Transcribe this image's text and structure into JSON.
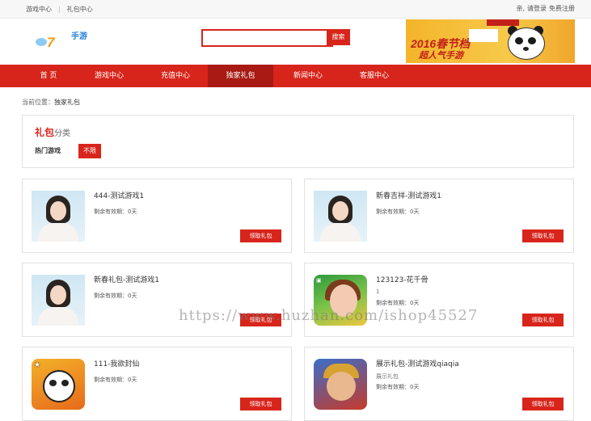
{
  "topbar": {
    "left_links": [
      "游戏中心",
      "礼包中心"
    ],
    "right_prefix": "亲,",
    "login": "请登录",
    "register": "免费注册"
  },
  "header": {
    "logo_text_num": "7",
    "logo_text_brand": "手游",
    "search_placeholder": "",
    "search_button": "搜索",
    "banner_line1": "2016春节档",
    "banner_line2": "超人气手游"
  },
  "nav": {
    "items": [
      "首 页",
      "游戏中心",
      "充值中心",
      "独家礼包",
      "新闻中心",
      "客服中心"
    ],
    "active_index": 3
  },
  "breadcrumb": {
    "prefix": "当前位置：",
    "current": "独家礼包"
  },
  "category": {
    "title_red": "礼包",
    "title_gray": "分类",
    "hot_label": "热门游戏",
    "filter_button": "不限"
  },
  "cards": [
    {
      "name": "444-测试游戏1",
      "meta": "剩余有效期：0天",
      "sub": "",
      "button": "领取礼包",
      "thumb": "lady-thumbnail"
    },
    {
      "name": "新春吉祥-测试游戏1",
      "meta": "剩余有效期：0天",
      "sub": "",
      "button": "领取礼包",
      "thumb": "lady-thumbnail"
    },
    {
      "name": "新春礼包-测试游戏1",
      "meta": "剩余有效期：0天",
      "sub": "",
      "button": "领取礼包",
      "thumb": "lady-thumbnail"
    },
    {
      "name": "123123-花千骨",
      "meta": "剩余有效期：0天",
      "sub": "1",
      "button": "领取礼包",
      "thumb": "game-icon-huaqiangu"
    },
    {
      "name": "111-我欲封仙",
      "meta": "剩余有效期：0天",
      "sub": "",
      "button": "领取礼包",
      "thumb": "game-icon-panda"
    },
    {
      "name": "展示礼包-测试游戏qiaqia",
      "meta": "剩余有效期：0天",
      "sub": "展示礼包",
      "button": "领取礼包",
      "thumb": "game-icon-warrior"
    }
  ],
  "watermark": "https://www.huzhan.com/ishop45527",
  "colors": {
    "brand_red": "#d8251b",
    "nav_active": "#a81a13"
  }
}
